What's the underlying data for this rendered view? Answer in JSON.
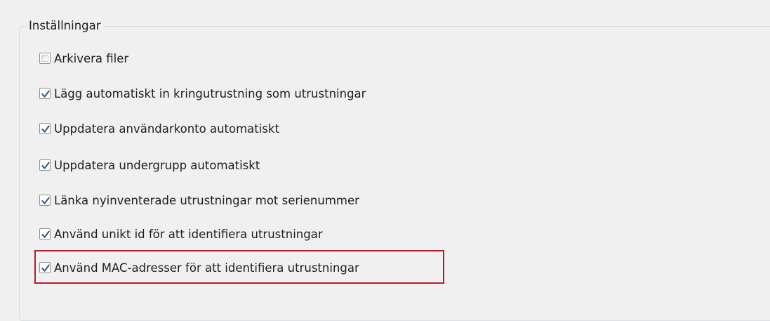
{
  "group": {
    "title": "Inställningar"
  },
  "options": [
    {
      "label": "Arkivera filer",
      "checked": false
    },
    {
      "label": "Lägg automatiskt in kringutrustning som utrustningar",
      "checked": true
    },
    {
      "label": "Uppdatera användarkonto automatiskt",
      "checked": true
    },
    {
      "label": "Uppdatera undergrupp automatiskt",
      "checked": true
    },
    {
      "label": "Länka nyinventerade utrustningar mot serienummer",
      "checked": true
    },
    {
      "label": "Använd unikt id för att identifiera utrustningar",
      "checked": true
    },
    {
      "label": "Använd MAC-adresser för att identifiera utrustningar",
      "checked": true
    }
  ],
  "colors": {
    "checkmark": "#3c5e8d",
    "highlight_border": "#b3212a"
  },
  "icons": {
    "checked": "checkmark-icon"
  }
}
